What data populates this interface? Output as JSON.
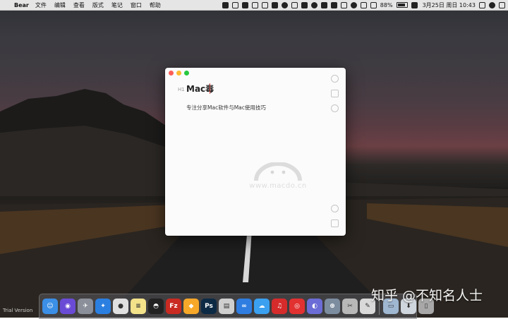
{
  "menubar": {
    "app_name": "Bear",
    "items": [
      "文件",
      "编辑",
      "查看",
      "版式",
      "笔记",
      "窗口",
      "帮助"
    ],
    "battery": "88%",
    "clock": "3月25日 周日 10:43"
  },
  "window": {
    "heading_marker": "H1",
    "title": "Mac毒",
    "body": "专注分享Mac软件与Mac使用技巧",
    "watermark": "www.macdo.cn"
  },
  "dock": {
    "apps": [
      {
        "name": "finder-icon",
        "color": "#3b8fe6",
        "glyph": "☺"
      },
      {
        "name": "siri-icon",
        "color": "#6a4bd6",
        "glyph": "◉"
      },
      {
        "name": "launchpad-icon",
        "color": "#8a8f99",
        "glyph": "✈"
      },
      {
        "name": "safari-icon",
        "color": "#2b7fe0",
        "glyph": "✦"
      },
      {
        "name": "chrome-icon",
        "color": "#e0e0e0",
        "glyph": "●"
      },
      {
        "name": "notes-icon",
        "color": "#f3e28a",
        "glyph": "≡"
      },
      {
        "name": "qq-icon",
        "color": "#222222",
        "glyph": "◓"
      },
      {
        "name": "filezilla-icon",
        "color": "#c92a22",
        "glyph": "Fz"
      },
      {
        "name": "sketch-icon",
        "color": "#f7a829",
        "glyph": "◆"
      },
      {
        "name": "photoshop-icon",
        "color": "#0d2a45",
        "glyph": "Ps"
      },
      {
        "name": "scanner-icon",
        "color": "#cfcfcf",
        "glyph": "▤"
      },
      {
        "name": "baidu-cloud-icon",
        "color": "#2f7de1",
        "glyph": "∞"
      },
      {
        "name": "icloud-icon",
        "color": "#3ba0f0",
        "glyph": "☁"
      },
      {
        "name": "netease-music-icon",
        "color": "#d62b2b",
        "glyph": "♫"
      },
      {
        "name": "netease-cloud-icon",
        "color": "#e23131",
        "glyph": "◎"
      },
      {
        "name": "istat-icon",
        "color": "#6c6cd6",
        "glyph": "◐"
      },
      {
        "name": "network-utility-icon",
        "color": "#7d8da0",
        "glyph": "⊕"
      },
      {
        "name": "xcode-tools-icon",
        "color": "#b8b8b8",
        "glyph": "✂"
      },
      {
        "name": "preview-icon",
        "color": "#d9d9d9",
        "glyph": "✎"
      },
      {
        "name": "folder-icon",
        "color": "#9fb7d1",
        "glyph": "▭"
      },
      {
        "name": "downloads-icon",
        "color": "#d0d6de",
        "glyph": "⬇"
      },
      {
        "name": "trash-icon",
        "color": "#a8a8a8",
        "glyph": "▯"
      }
    ]
  },
  "overlay": {
    "trial_text": "Trial Version",
    "zhihu_watermark": "知乎 @不知名人士"
  }
}
